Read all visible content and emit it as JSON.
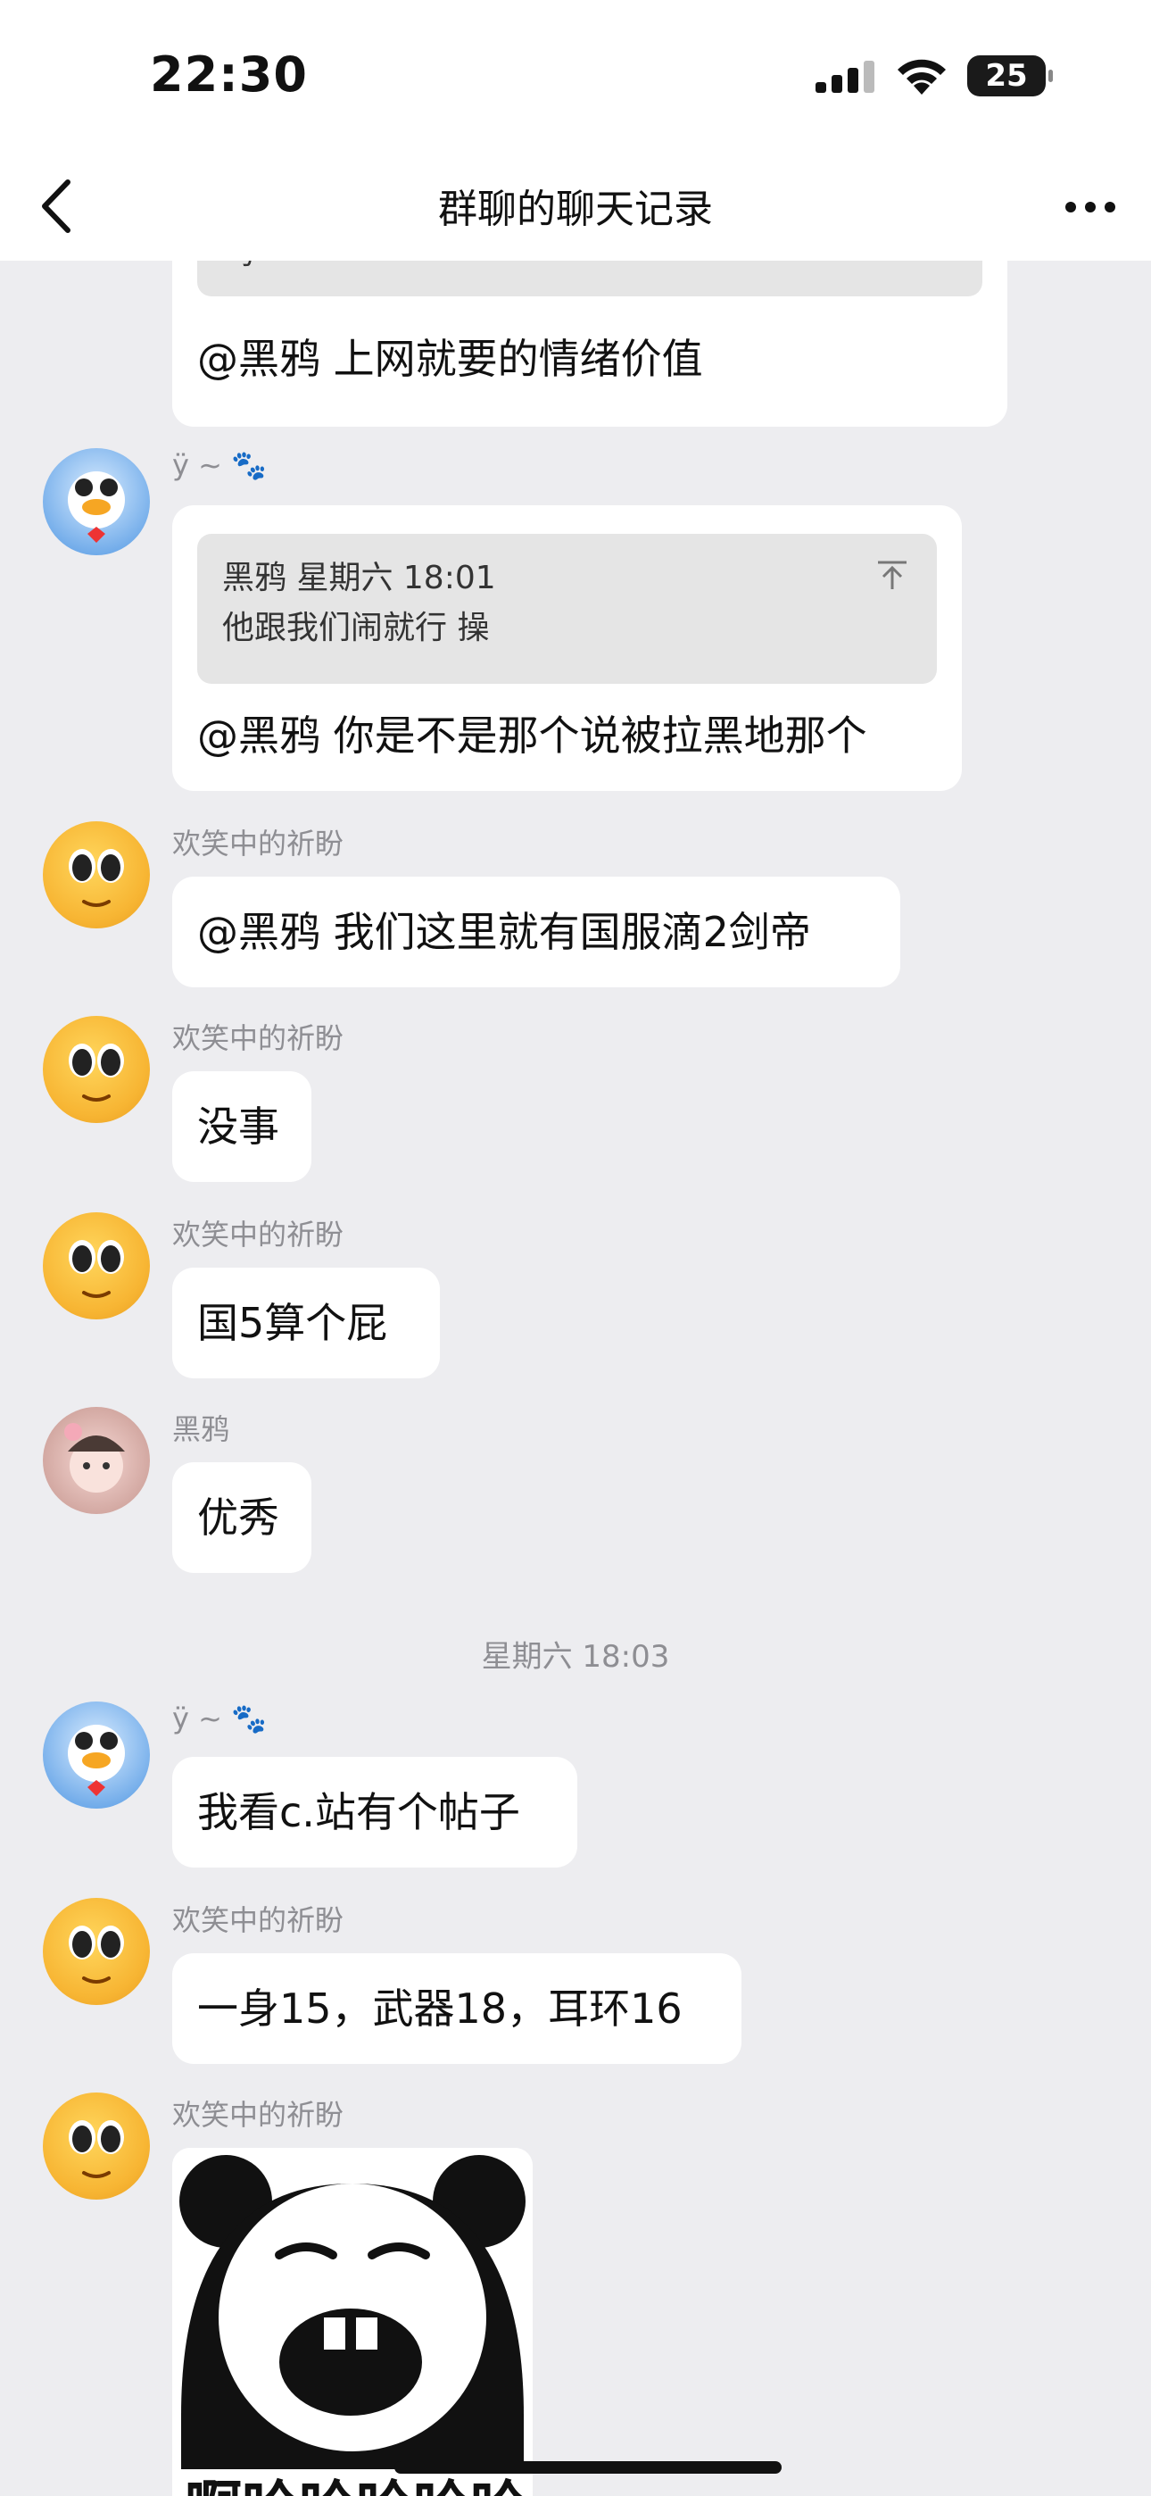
{
  "status_bar": {
    "time": "22:30",
    "battery": "25"
  },
  "nav": {
    "title": "群聊的聊天记录"
  },
  "messages": {
    "m0": {
      "quote_tail": "吗",
      "text": "@黑鸦 上网就要的情绪价值"
    },
    "m1": {
      "sender": "ÿ ~ 🐾",
      "quote_header": "黑鸦  星期六 18:01",
      "quote_text": "他跟我们闹就行 操",
      "text": "@黑鸦 你是不是那个说被拉黑地那个"
    },
    "m2": {
      "sender": "欢笑中的祈盼",
      "text": "@黑鸦 我们这里就有国服滴2剑帝"
    },
    "m3": {
      "sender": "欢笑中的祈盼",
      "text": "没事"
    },
    "m4": {
      "sender": "欢笑中的祈盼",
      "text": "国5算个屁"
    },
    "m5": {
      "sender": "黑鸦",
      "text": "优秀"
    },
    "divider": {
      "text": "星期六 18:03"
    },
    "m6": {
      "sender": "ÿ ~ 🐾",
      "text": "我看c.站有个帖子"
    },
    "m7": {
      "sender": "欢笑中的祈盼",
      "text": "一身15，武器18，耳环16"
    },
    "m8": {
      "sender": "欢笑中的祈盼",
      "sticker_caption": "啊哈哈哈哈哈"
    }
  },
  "colors": {
    "background": "#ededf0",
    "bubble": "#ffffff",
    "quote": "#e5e5e5",
    "meta_text": "#8e8e93"
  }
}
